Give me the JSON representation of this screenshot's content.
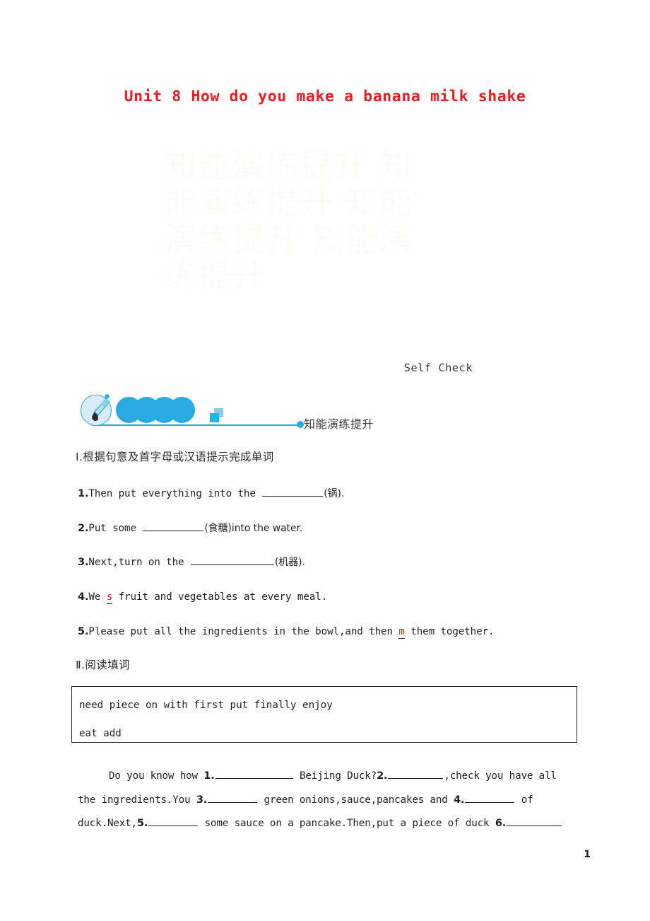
{
  "document": {
    "title": "Unit 8 How do you make a banana milk shake",
    "title_color": "#ec1c24",
    "section_marker": "Self Check",
    "page_number": "1",
    "watermark_text": "知能演练提升 知能演练提升 知能演练提升 知能演练提升"
  },
  "banner": {
    "label": "知能演练提升",
    "accent_color": "#29abe2",
    "icon": "paintbrush-icon"
  },
  "section1": {
    "heading": "Ⅰ.根据句意及首字母或汉语提示完成单词",
    "questions": [
      {
        "number": "1.",
        "before": "Then put everything into the ",
        "blank_width": "w86",
        "hint_letter": "",
        "after": "(锅).",
        "after_cn": "(锅)."
      },
      {
        "number": "2.",
        "before": "Put some ",
        "blank_width": "w86",
        "hint_letter": "",
        "after": "(食糖)into the water."
      },
      {
        "number": "3.",
        "before": "Next,turn on the ",
        "blank_width": "w118",
        "hint_letter": "",
        "after": "(机器)."
      },
      {
        "number": "4.",
        "before": "We ",
        "blank_width": "w72",
        "hint_letter": "s",
        "after": " fruit and vegetables at every meal."
      },
      {
        "number": "5.",
        "before": "Please put all the ingredients in the bowl,and then ",
        "blank_width": "w72",
        "hint_letter": "m",
        "after": " them together."
      }
    ]
  },
  "section2": {
    "heading": "Ⅱ.阅读填词",
    "wordbank": {
      "line1": "need  piece  on  with  first  put  finally  enjoy",
      "line2": "eat  add"
    },
    "passage": {
      "line1_a": "Do you know how ",
      "line1_n1": "1.",
      "line1_b": " Beijing Duck?",
      "line1_n2": "2.",
      "line1_c": ",check you have all",
      "line2_a": "the ingredients.You ",
      "line2_n3": "3.",
      "line2_b": " green onions,sauce,pancakes and ",
      "line2_n4": "4.",
      "line2_c": " of",
      "line3_a": "duck.Next,",
      "line3_n5": "5.",
      "line3_b": " some sauce on a pancake.Then,put a piece of duck ",
      "line3_n6": "6."
    }
  }
}
